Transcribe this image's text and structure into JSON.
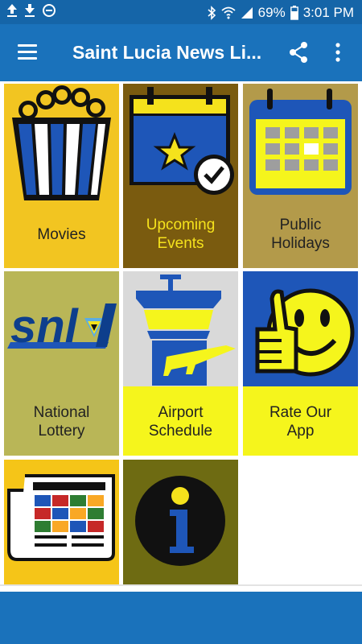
{
  "status_bar": {
    "battery": "69%",
    "time": "3:01 PM"
  },
  "app_bar": {
    "title": "Saint Lucia News Li...",
    "menu_icon": "hamburger-menu-icon",
    "share_icon": "share-icon",
    "more_icon": "more-vert-icon"
  },
  "tiles": [
    {
      "label": "Movies",
      "icon": "popcorn-icon",
      "bg": "#f2c521"
    },
    {
      "label": "Upcoming\nEvents",
      "icon": "calendar-star-icon",
      "bg": "#7a5b0f"
    },
    {
      "label": "Public\nHolidays",
      "icon": "calendar-icon",
      "bg": "#b39a4a"
    },
    {
      "label": "National\nLottery",
      "icon": "snl-logo-icon",
      "bg": "#b9b657"
    },
    {
      "label": "Airport\nSchedule",
      "icon": "airport-tower-icon",
      "bg": "#f5f51c"
    },
    {
      "label": "Rate Our\nApp",
      "icon": "thumbs-up-smiley-icon",
      "bg": "#f5f51c"
    },
    {
      "label": "",
      "icon": "newspaper-flags-icon",
      "bg": "#f5c518"
    },
    {
      "label": "",
      "icon": "info-icon",
      "bg": "#6e6b12"
    }
  ]
}
